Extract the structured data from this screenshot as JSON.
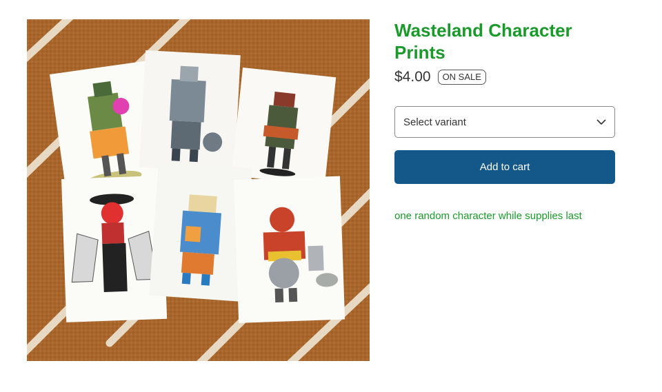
{
  "product": {
    "title": "Wasteland Character Prints",
    "price": "$4.00",
    "sale_badge": "ON SALE",
    "variant_placeholder": "Select variant",
    "add_to_cart_label": "Add to cart",
    "description": "one random character while supplies last"
  },
  "colors": {
    "accent_green": "#1a9a2a",
    "button_blue": "#135888",
    "rug_brown": "#a9662a"
  },
  "icons": {
    "dropdown": "chevron-down-icon"
  }
}
